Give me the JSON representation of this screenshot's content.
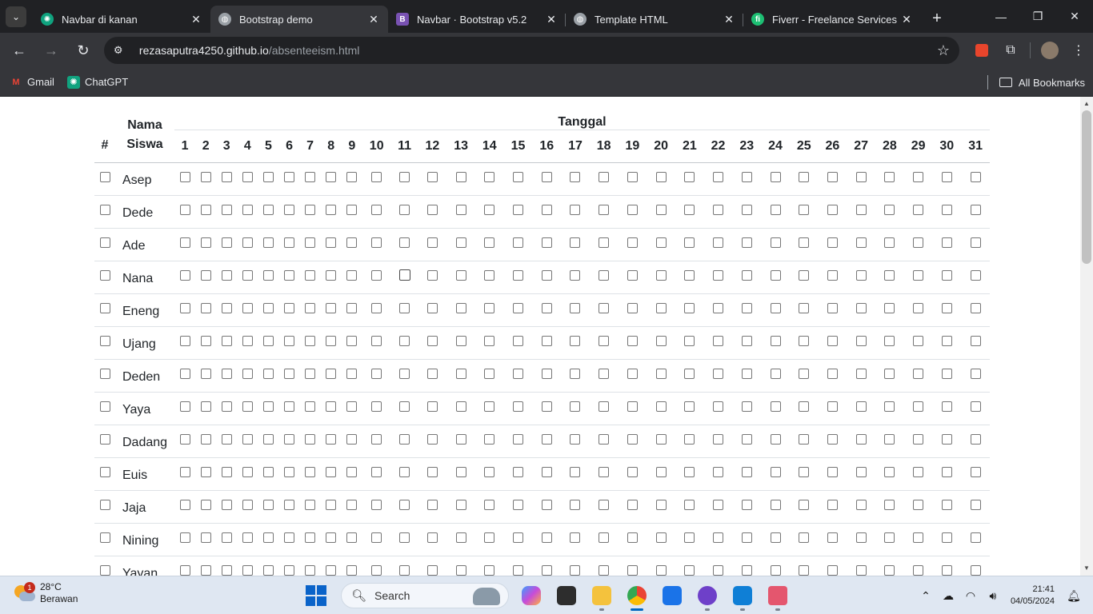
{
  "browser": {
    "tabs": [
      {
        "title": "Navbar di kanan",
        "icon": "chatgpt-icon",
        "color": "#10a37f",
        "active": false
      },
      {
        "title": "Bootstrap demo",
        "icon": "globe-icon",
        "color": "#9aa0a6",
        "active": true
      },
      {
        "title": "Navbar · Bootstrap v5.2",
        "icon": "bootstrap-icon",
        "color": "#7952b3",
        "active": false
      },
      {
        "title": "Template HTML",
        "icon": "globe-icon",
        "color": "#9aa0a6",
        "active": false
      },
      {
        "title": "Fiverr - Freelance Services M",
        "icon": "fiverr-icon",
        "color": "#1dbf73",
        "active": false
      }
    ],
    "url_host": "rezasaputra4250.github.io",
    "url_path": "/absenteeism.html",
    "bookmarks": [
      {
        "label": "Gmail",
        "icon": "gmail-icon"
      },
      {
        "label": "ChatGPT",
        "icon": "chatgpt-icon"
      }
    ],
    "all_bookmarks": "All Bookmarks"
  },
  "table": {
    "hash_header": "#",
    "name_header_line1": "Nama",
    "name_header_line2": "Siswa",
    "date_group_header": "Tanggal",
    "days": [
      "1",
      "2",
      "3",
      "4",
      "5",
      "6",
      "7",
      "8",
      "9",
      "10",
      "11",
      "12",
      "13",
      "14",
      "15",
      "16",
      "17",
      "18",
      "19",
      "20",
      "21",
      "22",
      "23",
      "24",
      "25",
      "26",
      "27",
      "28",
      "29",
      "30",
      "31"
    ],
    "students": [
      "Asep",
      "Dede",
      "Ade",
      "Nana",
      "Eneng",
      "Ujang",
      "Deden",
      "Yaya",
      "Dadang",
      "Euis",
      "Jaja",
      "Nining",
      "Yayan"
    ]
  },
  "taskbar": {
    "weather_temp": "28°C",
    "weather_desc": "Berawan",
    "weather_badge": "1",
    "search_label": "Search",
    "time": "21:41",
    "date": "04/05/2024"
  }
}
